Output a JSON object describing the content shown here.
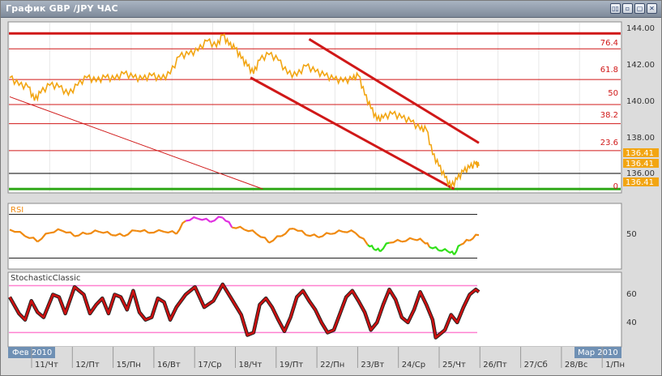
{
  "window": {
    "title": "График GBP /JPY  ЧАС",
    "buttons": [
      "▯▯",
      "▫",
      "▢",
      "✕"
    ]
  },
  "colors": {
    "price": "#f2a512",
    "fib": "#d01818",
    "channel": "#d01818",
    "support": "#30a818",
    "rsi": "#f08a10",
    "rsi_overbought": "#e030e0",
    "rsi_oversold": "#30e018",
    "stoch": "#cc1010",
    "stoch_levels": "#ff80d0",
    "axis_tag": "#f2a512"
  },
  "main_axis": {
    "ticks": [
      "144.00",
      "142.00",
      "140.00",
      "138.00",
      "136.00"
    ],
    "price_tags": [
      "136.41",
      "136.41",
      "136.41"
    ]
  },
  "fib_labels": [
    "76.4",
    "61.8",
    "50",
    "38.2",
    "23.6",
    "0"
  ],
  "rsi_panel": {
    "label": "RSI",
    "tick": "50"
  },
  "stoch_panel": {
    "label": "StochasticClassic",
    "ticks": [
      "60",
      "40"
    ]
  },
  "time_axis": {
    "left_tag": "Фев 2010",
    "right_tag": "Мар 2010",
    "labels": [
      "11/Чт",
      "12/Пт",
      "15/Пн",
      "16/Вт",
      "17/Ср",
      "18/Чт",
      "19/Пт",
      "22/Пн",
      "23/Вт",
      "24/Ср",
      "25/Чт",
      "26/Пт",
      "27/Сб",
      "28/Вс",
      "1/Пн"
    ]
  },
  "chart_data": {
    "type": "line",
    "price_ylim": [
      135.4,
      144.3
    ],
    "fib_levels": {
      "0": 135.6,
      "23.6": 137.6,
      "38.2": 139.0,
      "50": 140.0,
      "61.8": 141.3,
      "76.4": 142.9,
      "100": 143.7
    },
    "price_series": [
      [
        0,
        141.4
      ],
      [
        3,
        141.0
      ],
      [
        6,
        140.9
      ],
      [
        8,
        140.2
      ],
      [
        10,
        140.6
      ],
      [
        13,
        141.0
      ],
      [
        16,
        140.9
      ],
      [
        19,
        140.5
      ],
      [
        22,
        141.0
      ],
      [
        25,
        141.4
      ],
      [
        28,
        141.2
      ],
      [
        31,
        141.4
      ],
      [
        34,
        141.3
      ],
      [
        37,
        141.6
      ],
      [
        40,
        141.4
      ],
      [
        43,
        141.3
      ],
      [
        46,
        141.5
      ],
      [
        49,
        141.3
      ],
      [
        52,
        141.6
      ],
      [
        55,
        142.5
      ],
      [
        58,
        142.6
      ],
      [
        61,
        142.8
      ],
      [
        64,
        143.3
      ],
      [
        67,
        143.0
      ],
      [
        69,
        143.6
      ],
      [
        71,
        143.1
      ],
      [
        73,
        142.9
      ],
      [
        75,
        142.4
      ],
      [
        77,
        142.0
      ],
      [
        79,
        141.6
      ],
      [
        81,
        142.3
      ],
      [
        84,
        142.6
      ],
      [
        87,
        142.3
      ],
      [
        90,
        141.6
      ],
      [
        93,
        141.5
      ],
      [
        96,
        142.0
      ],
      [
        99,
        141.7
      ],
      [
        102,
        141.5
      ],
      [
        105,
        141.3
      ],
      [
        108,
        141.2
      ],
      [
        111,
        141.3
      ],
      [
        113,
        141.5
      ],
      [
        115,
        140.5
      ],
      [
        117,
        139.8
      ],
      [
        119,
        139.2
      ],
      [
        121,
        139.3
      ],
      [
        124,
        139.5
      ],
      [
        127,
        139.3
      ],
      [
        130,
        139.1
      ],
      [
        133,
        138.7
      ],
      [
        135,
        138.7
      ],
      [
        137,
        137.4
      ],
      [
        139,
        136.8
      ],
      [
        141,
        136.2
      ],
      [
        143,
        135.7
      ],
      [
        145,
        136.1
      ],
      [
        147,
        136.5
      ],
      [
        149,
        136.7
      ],
      [
        151,
        136.9
      ],
      [
        152,
        136.8
      ]
    ],
    "rsi_series": [
      [
        0,
        56
      ],
      [
        5,
        50
      ],
      [
        9,
        45
      ],
      [
        13,
        53
      ],
      [
        17,
        55
      ],
      [
        21,
        50
      ],
      [
        25,
        52
      ],
      [
        29,
        54
      ],
      [
        33,
        51
      ],
      [
        37,
        50
      ],
      [
        41,
        55
      ],
      [
        45,
        53
      ],
      [
        50,
        54
      ],
      [
        54,
        52
      ],
      [
        57,
        64
      ],
      [
        61,
        66
      ],
      [
        65,
        63
      ],
      [
        69,
        67
      ],
      [
        72,
        58
      ],
      [
        76,
        56
      ],
      [
        80,
        52
      ],
      [
        84,
        44
      ],
      [
        88,
        50
      ],
      [
        92,
        57
      ],
      [
        96,
        51
      ],
      [
        100,
        49
      ],
      [
        104,
        52
      ],
      [
        108,
        54
      ],
      [
        112,
        53
      ],
      [
        116,
        42
      ],
      [
        118,
        38
      ],
      [
        120,
        36
      ],
      [
        123,
        44
      ],
      [
        127,
        45
      ],
      [
        131,
        47
      ],
      [
        134,
        45
      ],
      [
        136,
        40
      ],
      [
        139,
        37
      ],
      [
        142,
        36
      ],
      [
        144,
        33
      ],
      [
        146,
        42
      ],
      [
        149,
        46
      ],
      [
        152,
        51
      ]
    ],
    "rsi_levels": [
      70,
      30
    ],
    "stoch_series": [
      [
        0,
        58
      ],
      [
        3,
        45
      ],
      [
        5,
        40
      ],
      [
        7,
        55
      ],
      [
        9,
        46
      ],
      [
        11,
        42
      ],
      [
        14,
        60
      ],
      [
        16,
        58
      ],
      [
        18,
        45
      ],
      [
        21,
        66
      ],
      [
        24,
        60
      ],
      [
        26,
        45
      ],
      [
        28,
        52
      ],
      [
        30,
        57
      ],
      [
        32,
        45
      ],
      [
        34,
        60
      ],
      [
        36,
        58
      ],
      [
        38,
        48
      ],
      [
        40,
        63
      ],
      [
        42,
        46
      ],
      [
        44,
        40
      ],
      [
        46,
        42
      ],
      [
        48,
        57
      ],
      [
        50,
        54
      ],
      [
        52,
        40
      ],
      [
        54,
        50
      ],
      [
        57,
        60
      ],
      [
        60,
        66
      ],
      [
        63,
        50
      ],
      [
        66,
        55
      ],
      [
        69,
        68
      ],
      [
        72,
        56
      ],
      [
        75,
        44
      ],
      [
        77,
        28
      ],
      [
        79,
        30
      ],
      [
        81,
        52
      ],
      [
        83,
        57
      ],
      [
        85,
        50
      ],
      [
        87,
        40
      ],
      [
        89,
        31
      ],
      [
        91,
        42
      ],
      [
        93,
        58
      ],
      [
        95,
        63
      ],
      [
        97,
        55
      ],
      [
        99,
        48
      ],
      [
        101,
        38
      ],
      [
        103,
        30
      ],
      [
        105,
        32
      ],
      [
        107,
        45
      ],
      [
        109,
        58
      ],
      [
        111,
        63
      ],
      [
        113,
        55
      ],
      [
        115,
        46
      ],
      [
        117,
        32
      ],
      [
        119,
        38
      ],
      [
        121,
        52
      ],
      [
        123,
        64
      ],
      [
        125,
        56
      ],
      [
        127,
        42
      ],
      [
        129,
        38
      ],
      [
        131,
        48
      ],
      [
        133,
        62
      ],
      [
        135,
        52
      ],
      [
        137,
        40
      ],
      [
        138,
        26
      ],
      [
        140,
        30
      ],
      [
        141,
        32
      ],
      [
        143,
        44
      ],
      [
        145,
        38
      ],
      [
        147,
        50
      ],
      [
        149,
        60
      ],
      [
        151,
        64
      ],
      [
        152,
        62
      ]
    ],
    "stoch_levels": [
      67,
      30
    ]
  }
}
